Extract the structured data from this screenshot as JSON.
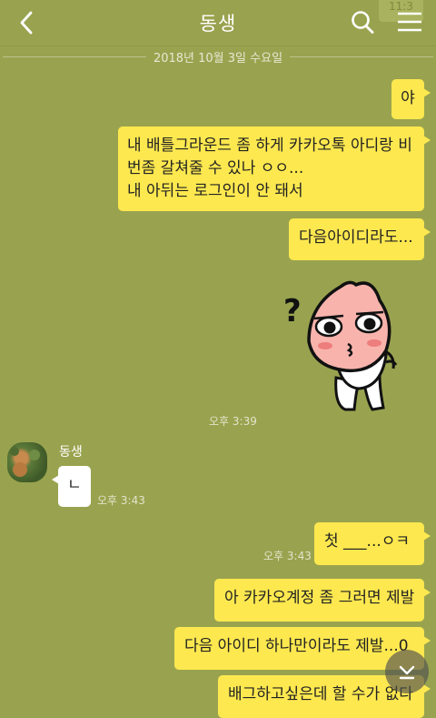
{
  "header": {
    "title": "동생",
    "peek_text": "11:3"
  },
  "date_divider": "2018년 10월 3일 수요일",
  "messages_top": [
    {
      "text": "야"
    },
    {
      "lines": [
        "내 배틀그라운드 좀 하게 카카오톡 아디랑 비",
        "번좀 갈쳐줄 수 있나 ㅇㅇ...",
        "내 아뒤는 로그인이 안 돼서"
      ]
    },
    {
      "text": "다음아이디라도..."
    }
  ],
  "sticker": {
    "question_mark": "?",
    "time": "오후 3:39"
  },
  "reply": {
    "sender": "동생",
    "text": "ㄴ",
    "time": "오후 3:43"
  },
  "messages_bottom": [
    {
      "text": "첫 ___...ㅇㅋ",
      "time": "오후 3:43"
    },
    {
      "text": "아 카카오계정 좀 그러면 제발"
    },
    {
      "text": "다음 아이디 하나만이라도 제발...0"
    },
    {
      "text": "배그하고싶은데 할 수가 없다"
    }
  ]
}
